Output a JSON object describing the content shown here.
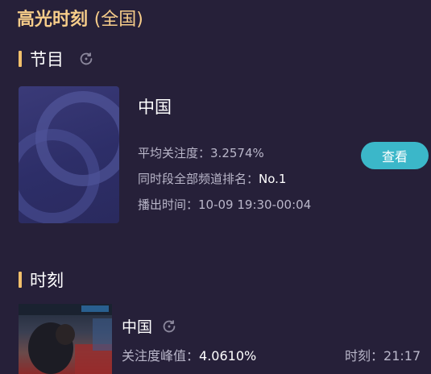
{
  "header": {
    "title": "高光时刻",
    "scope": "(全国)"
  },
  "program_section": {
    "label": "节目",
    "refresh_icon": "refresh-icon",
    "program": {
      "name": "中国",
      "avg_attention_label": "平均关注度：",
      "avg_attention_value": "3.2574%",
      "rank_label": "同时段全部频道排名：",
      "rank_value": "No.1",
      "airtime_label": "播出时间：",
      "airtime_value": "10-09 19:30-00:04",
      "view_button": "查看"
    }
  },
  "moment_section": {
    "label": "时刻",
    "moment": {
      "name": "中国",
      "refresh_icon": "refresh-icon",
      "peak_label": "关注度峰值：",
      "peak_value": "4.0610%",
      "time_label": "时刻：",
      "time_value": "21:17"
    }
  },
  "colors": {
    "background": "#262039",
    "accent_title": "#f7cd8a",
    "section_bar": "#f2c06b",
    "button": "#3bb7c9"
  }
}
